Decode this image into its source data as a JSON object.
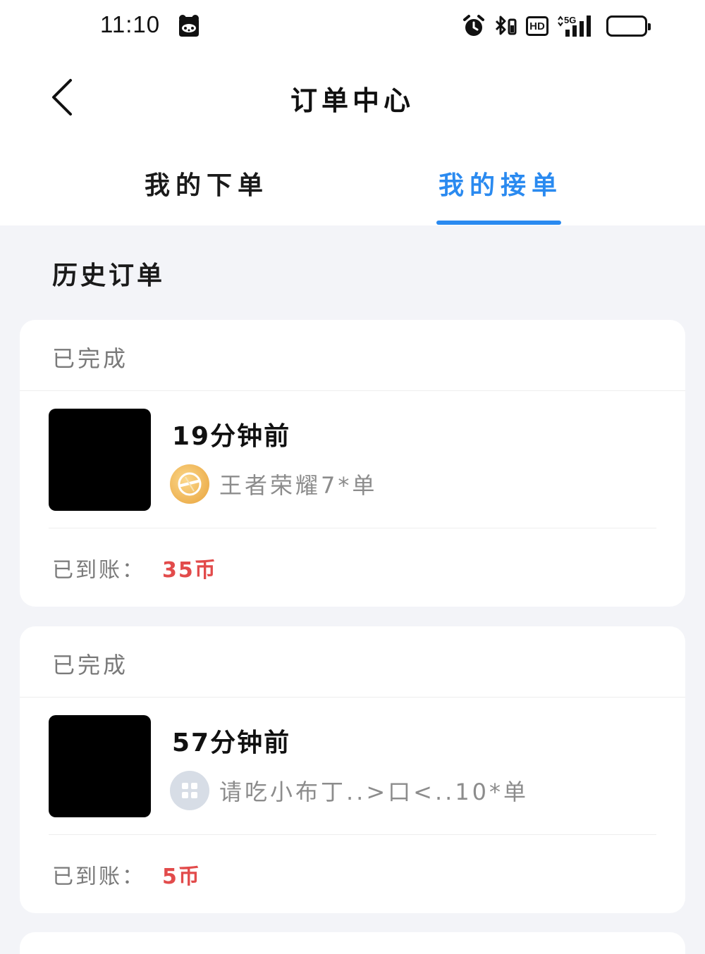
{
  "status_bar": {
    "time": "11:10",
    "hd_label": "HD",
    "network_label": "5G",
    "battery_fill_fraction": 0.5,
    "battery_color": "#f5c12b"
  },
  "nav": {
    "title": "订单中心"
  },
  "tabs": [
    {
      "label": "我的下单",
      "active": false
    },
    {
      "label": "我的接单",
      "active": true
    }
  ],
  "accent_color": "#2a8af0",
  "section": {
    "title": "历史订单"
  },
  "orders": [
    {
      "status": "已完成",
      "time_ago": "19分钟前",
      "game_icon": "honor-of-kings-icon",
      "game_desc": "王者荣耀7*单",
      "earn_label": "已到账：",
      "earn_value": "35币"
    },
    {
      "status": "已完成",
      "time_ago": "57分钟前",
      "game_icon": "apps-grid-icon",
      "game_desc": "请吃小布丁..>口<..10*单",
      "earn_label": "已到账：",
      "earn_value": "5币"
    }
  ]
}
